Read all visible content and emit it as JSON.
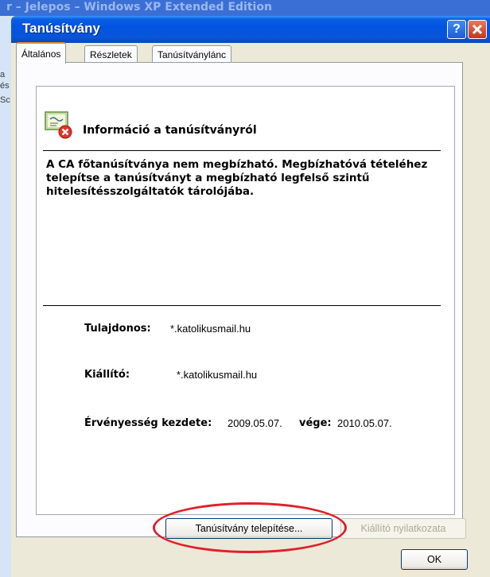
{
  "background": {
    "title_fragment": "r – Jelepos – Windows XP Extended Edition",
    "left_fragments": [
      "a",
      "és",
      "Sc"
    ]
  },
  "dialog": {
    "title": "Tanúsítvány",
    "help_button": "?",
    "close_button": "X"
  },
  "tabs": [
    {
      "label": "Általános",
      "active": true
    },
    {
      "label": "Részletek",
      "active": false
    },
    {
      "label": "Tanúsítványlánc",
      "active": false
    }
  ],
  "cert_info": {
    "title": "Információ a tanúsítványról",
    "message": "A CA főtanúsítványa nem megbízható. Megbízhatóvá tételéhez telepítse a tanúsítványt a megbízható legfelső szintű hitelesítésszolgáltatók tárolójába."
  },
  "owner": {
    "label": "Tulajdonos:",
    "value": "*.katolikusmail.hu"
  },
  "issuer": {
    "label": "Kiállító:",
    "value": "*.katolikusmail.hu"
  },
  "validity": {
    "from_label": "Érvényesség kezdete:",
    "from_value": "2009.05.07.",
    "to_label": "vége:",
    "to_value": "2010.05.07."
  },
  "buttons": {
    "install": "Tanúsítvány telepítése...",
    "issuer_statement": "Kiállító nyilatkozata",
    "ok": "OK"
  },
  "colors": {
    "titlebar": "#0054e3",
    "dialog_bg": "#ece9d8",
    "highlight_ellipse": "#e0202a",
    "active_tab_accent": "#e68b2c"
  },
  "icons": {
    "certificate": "certificate-error-icon"
  }
}
